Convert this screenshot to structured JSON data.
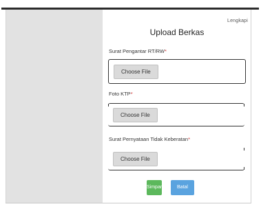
{
  "modal": {
    "close_label": "Lengkapi",
    "title": "Upload Berkas",
    "fields": [
      {
        "label": "Surat Pengantar RT/RW",
        "required_mark": "*",
        "button": "Choose File"
      },
      {
        "label": "Foto KTP",
        "required_mark": "*",
        "button": "Choose File"
      },
      {
        "label": "Surat Pernyataan Tidak Keberatan",
        "required_mark": "*",
        "button": "Choose File"
      }
    ],
    "save_label": "Simpan",
    "cancel_label": "Batal"
  },
  "colors": {
    "save": "#5cb85c",
    "cancel": "#5aa3df",
    "required": "#d23030"
  }
}
